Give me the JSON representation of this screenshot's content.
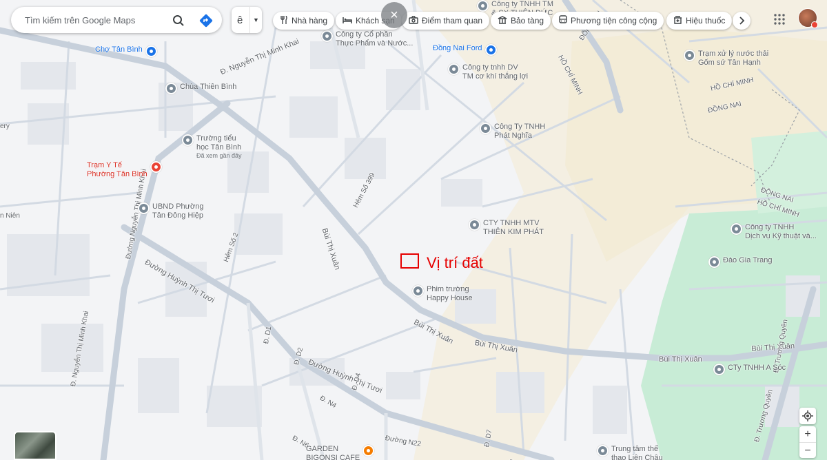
{
  "search": {
    "placeholder": "Tìm kiếm trên Google Maps"
  },
  "layers_label": "ê",
  "chips": [
    {
      "label": "Nhà hàng",
      "icon": "fork-knife-icon"
    },
    {
      "label": "Khách sạn",
      "icon": "bed-icon"
    },
    {
      "label": "Điểm tham quan",
      "icon": "camera-icon"
    },
    {
      "label": "Bảo tàng",
      "icon": "museum-icon"
    },
    {
      "label": "Phương tiện công cộng",
      "icon": "bus-icon"
    },
    {
      "label": "Hiệu thuốc",
      "icon": "pharmacy-icon"
    }
  ],
  "close_label": "×",
  "marker": {
    "label": "Vị trí đất",
    "color": "#e60000"
  },
  "colors": {
    "road": "#c7d0db",
    "park": "#c8ecd6",
    "land": "#f3f4f6",
    "sand": "#f4edda"
  },
  "streets": [
    "Đ. Nguyễn Thị Minh Khai",
    "Bùi Thị Xuân",
    "Hẻm Số 399",
    "Bùi Thị Xuân",
    "Bùi Thị Xuân",
    "Bùi Thị Xuân",
    "Bùi Thị Xuân",
    "Đường Huỳnh Thị Tươi",
    "Đường Huỳnh Thị Tươi",
    "Hẻm Số 2",
    "Đường Nguyễn Thị Minh Khai",
    "Đ. Nguyễn Thị Minh Khai",
    "Đ. D1",
    "Đ. D2",
    "Đ. D4",
    "Đ. N4",
    "Đ. N6",
    "Đường N22",
    "Đ. D7",
    "Đ. Trương Quyền",
    "Đ. Trương Quyền",
    "Đường Hu",
    "ĐỒNG NAI",
    "HỒ CHÍ MINH",
    "ĐỒNG NAI",
    "HỒ CHÍ MINH",
    "ĐỒNG NAI",
    "HỒ CHÍ MINH",
    "n Niên",
    "ery"
  ],
  "pois": [
    {
      "name": "Chợ Tân Bình",
      "color": "blue"
    },
    {
      "name": "Chùa Thiên Bình",
      "color": "gray"
    },
    {
      "name": "Trường tiểu\nhọc Tân Bình",
      "sub": "Đã xem gần đây",
      "color": "gray"
    },
    {
      "name": "Trạm Y Tế\nPhường Tân Bình",
      "color": "red"
    },
    {
      "name": "UBND Phường\nTân Đông Hiệp",
      "color": "gray"
    },
    {
      "name": "Công ty Cổ phần\nThực Phẩm và Nước...",
      "color": "gray"
    },
    {
      "name": "Công ty TNHH TM\n& SX THIÊN ĐỨC",
      "color": "gray"
    },
    {
      "name": "Đồng Nai Ford",
      "color": "blue"
    },
    {
      "name": "Công ty tnhh DV\nTM cơ khí thắng lợi",
      "color": "gray"
    },
    {
      "name": "Công Ty TNHH\nPhát Nghĩa",
      "color": "gray"
    },
    {
      "name": "CTY TNHH MTV\nTHIÊN KIM PHÁT",
      "color": "gray"
    },
    {
      "name": "Phim trường\nHappy House",
      "color": "gray"
    },
    {
      "name": "Trạm xử lý nước thải\nGốm sứ Tân Hạnh",
      "color": "gray"
    },
    {
      "name": "Công ty TNHH\nDịch vụ Kỹ thuật và...",
      "color": "gray"
    },
    {
      "name": "Đào Gia Trang",
      "color": "gray"
    },
    {
      "name": "CTy TNHH A Sóc",
      "color": "gray"
    },
    {
      "name": "Trung tâm thể\nthao Liên Châu",
      "color": "gray"
    },
    {
      "name": "GARDEN\nBIGONSI CAFE",
      "color": "orange"
    }
  ],
  "zoom": {
    "in": "+",
    "out": "−"
  }
}
